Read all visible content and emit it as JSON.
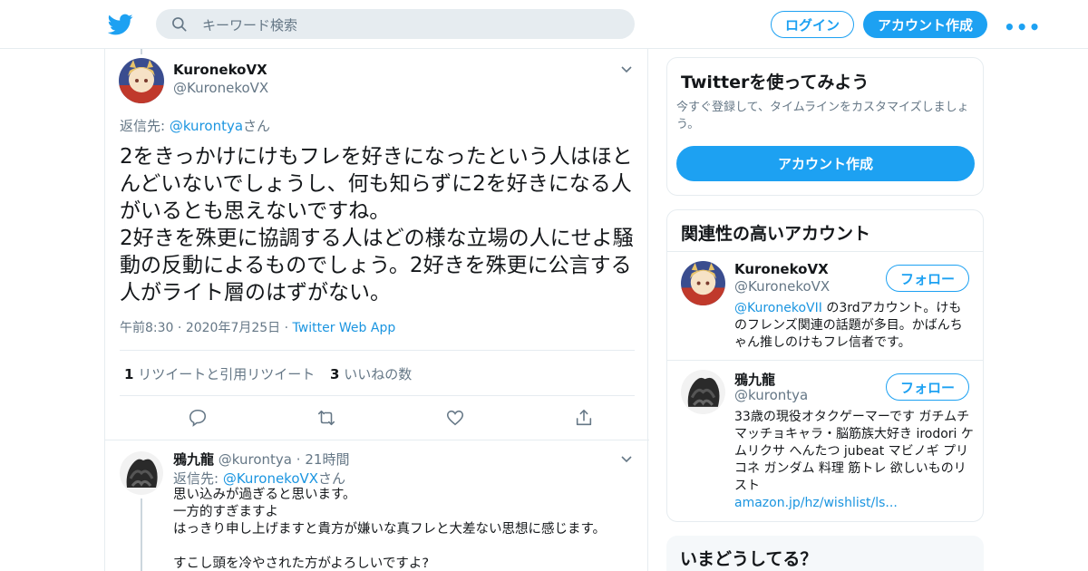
{
  "header": {
    "search_placeholder": "キーワード検索",
    "login_label": "ログイン",
    "signup_label": "アカウント作成",
    "more_label": "•••",
    "brand_color": "#1da1f2"
  },
  "tweet": {
    "name": "KuronekoVX",
    "handle": "@KuronekoVX",
    "replyto_prefix": "返信先: ",
    "replyto_mention": "@kurontya",
    "replyto_suffix": "さん",
    "text": "2をきっかけにけもフレを好きになったという人はほとんどいないでしょうし、何も知らずに2を好きになる人がいるとも思えないですね。\n2好きを殊更に協調する人はどの様な立場の人にせよ騒動の反動によるものでしょう。2好きを殊更に公言する人がライト層のはずがない。",
    "time": "午前8:30",
    "date": "2020年7月25日",
    "dot": "·",
    "source": "Twitter Web App",
    "retweet_count": "1",
    "retweet_label": "リツイートと引用リツイート",
    "like_count": "3",
    "like_label": "いいねの数"
  },
  "reply": {
    "name": "鴉九龍",
    "handle": "@kurontya",
    "dot": "·",
    "age": "21時間",
    "replyto_prefix": "返信先: ",
    "replyto_mention": "@KuronekoVX",
    "replyto_suffix": "さん",
    "text": "思い込みが過ぎると思います。\n一方的すぎますよ\nはっきり申し上げますと貴方が嫌いな真フレと大差ない思想に感じます。\n\nすこし頭を冷やされた方がよろしいですよ?"
  },
  "sidebar": {
    "signup_card": {
      "title": "Twitterを使ってみよう",
      "subtitle": "今すぐ登録して、タイムラインをカスタマイズしましょう。",
      "button": "アカウント作成"
    },
    "related": {
      "title": "関連性の高いアカウント",
      "follow_label": "フォロー",
      "accounts": [
        {
          "name": "KuronekoVX",
          "handle": "@KuronekoVX",
          "bio_link": "@KuronekoVII",
          "bio": " の3rdアカウント。けものフレンズ関連の話題が多目。かばんちゃん推しのけもフレ信者です。"
        },
        {
          "name": "鴉九龍",
          "handle": "@kurontya",
          "bio": "33歳の現役オタクゲーマーです ガチムチマッチョキャラ・脳筋族大好き irodori ケムリクサ へんたつ jubeat マビノギ プリコネ ガンダム 料理 筋トレ 欲しいものリスト",
          "bio_link": "amazon.jp/hz/wishlist/ls..."
        }
      ]
    },
    "trends": {
      "title": "いまどうしてる？"
    }
  }
}
